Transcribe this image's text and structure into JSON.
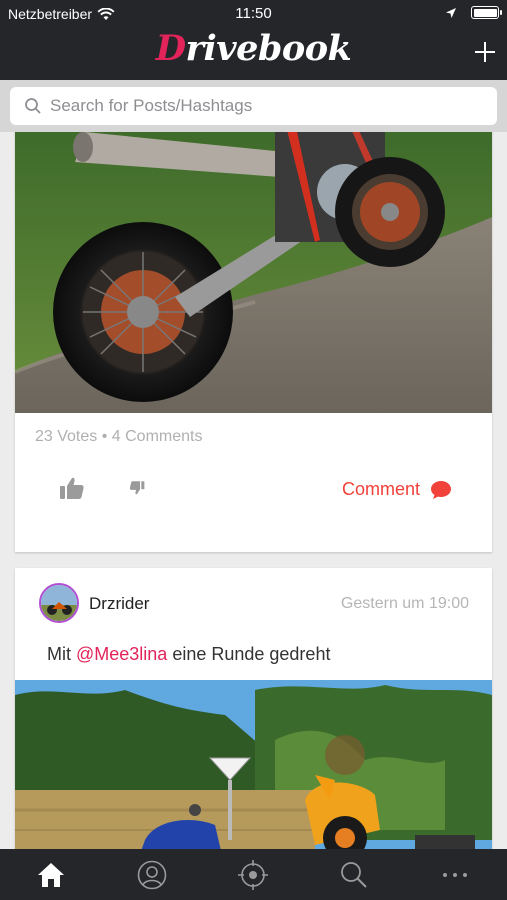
{
  "status_bar": {
    "carrier": "Netzbetreiber",
    "time": "11:50"
  },
  "header": {
    "logo_first": "D",
    "logo_rest": "rivebook"
  },
  "search": {
    "placeholder": "Search for Posts/Hashtags"
  },
  "posts": [
    {
      "stats": "23 Votes • 4 Comments",
      "comment_label": "Comment"
    },
    {
      "username": "Drzrider",
      "timestamp": "Gestern um 19:00",
      "caption_prefix": "Mit ",
      "mention": "@Mee3lina",
      "caption_suffix": " eine Runde gedreht"
    }
  ],
  "tabs": [
    "home-icon",
    "profile-icon",
    "map-target-icon",
    "search-icon",
    "more-icon"
  ],
  "colors": {
    "accent": "#e2245a",
    "comment": "#f0413a",
    "bar": "#24262a"
  }
}
